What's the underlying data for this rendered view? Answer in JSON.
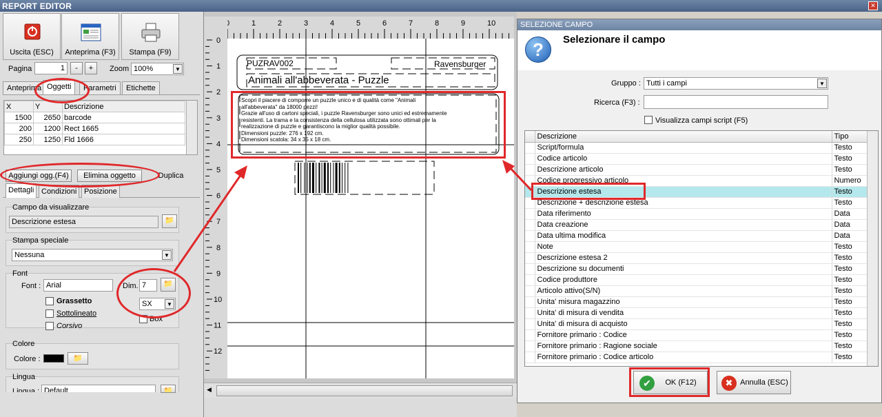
{
  "window": {
    "title": "REPORT EDITOR"
  },
  "toolbar": {
    "exit_label": "Uscita (ESC)",
    "preview_label": "Anteprima (F3)",
    "print_label": "Stampa (F9)",
    "page_label": "Pagina",
    "page_value": "1",
    "minus": "-",
    "plus": "+",
    "zoom_label": "Zoom",
    "zoom_value": "100%"
  },
  "tabs": {
    "preview": "Anteprima",
    "objects": "Oggetti",
    "params": "Parametri",
    "labels": "Etichette"
  },
  "objects": {
    "headers": [
      "X",
      "Y",
      "Descrizione"
    ],
    "rows": [
      [
        "1500",
        "2650",
        "barcode"
      ],
      [
        "200",
        "1200",
        "Rect 1665"
      ],
      [
        "250",
        "1250",
        "Fld 1666"
      ]
    ]
  },
  "obj_buttons": {
    "add": "Aggiungi ogg.(F4)",
    "delete": "Elimina oggetto",
    "duplicate": "Duplica"
  },
  "subtabs": {
    "details": "Dettagli",
    "conditions": "Condizioni",
    "position": "Posizione"
  },
  "field_group": {
    "title": "Campo da visualizzare",
    "value": "Descrizione estesa"
  },
  "special_group": {
    "title": "Stampa speciale",
    "value": "Nessuna"
  },
  "font_group": {
    "title": "Font",
    "font_label": "Font :",
    "font_value": "Arial",
    "dim_label": "Dim.",
    "dim_value": "7",
    "bold": "Grassetto",
    "underline": "Sottolineato",
    "italic": "Corsivo",
    "align_value": "SX",
    "box": "Box"
  },
  "color_group": {
    "title": "Colore",
    "label": "Colore :",
    "value": "#000000"
  },
  "lang_group": {
    "title": "Lingua",
    "label": "Lingua :",
    "value": "Default"
  },
  "ruler": {
    "top": [
      "0",
      "1",
      "2",
      "3",
      "4",
      "5",
      "6",
      "7",
      "8",
      "9",
      "10",
      "11"
    ],
    "left": [
      "0",
      "1",
      "2",
      "3",
      "4",
      "5",
      "6",
      "7",
      "8",
      "9",
      "10",
      "11",
      "12"
    ]
  },
  "label_preview": {
    "code": "PUZRAV002",
    "brand": "Ravensburger",
    "title": "Animali all'abbeverata - Puzzle",
    "desc_lines": [
      "Scopri il piacere di comporre un puzzle unico e di qualità come \"Animali",
      "all'abbeverata\" da 18000 pezzi!",
      "Grazie all'uso di cartoni speciali, i puzzle Ravensburger sono unici ed estremamente",
      "resistenti. La trama e la consistenza della cellulosa utilizzata sono ottimali per la",
      "realizzazione di puzzle e garantiscono la miglior qualità possibile.",
      "Dimensioni puzzle: 276 x 192 cm.",
      "Dimensioni scatola: 34 x 35 x 18 cm."
    ]
  },
  "dialog": {
    "title": "SELEZIONE CAMPO",
    "heading": "Selezionare il campo",
    "group_label": "Gruppo :",
    "group_value": "Tutti i campi",
    "search_label": "Ricerca (F3) :",
    "search_value": "",
    "script_label": "Visualizza campi script (F5)",
    "col_desc": "Descrizione",
    "col_type": "Tipo",
    "ok_label": "OK (F12)",
    "cancel_label": "Annulla (ESC)",
    "fields": [
      {
        "d": "Script/formula",
        "t": "Testo"
      },
      {
        "d": "Codice articolo",
        "t": "Testo"
      },
      {
        "d": "Descrizione articolo",
        "t": "Testo"
      },
      {
        "d": "Codice progressivo articolo",
        "t": "Numero"
      },
      {
        "d": "Descrizione estesa",
        "t": "Testo"
      },
      {
        "d": "Descrizione + descrizione estesa",
        "t": "Testo"
      },
      {
        "d": "Data riferimento",
        "t": "Data"
      },
      {
        "d": "Data creazione",
        "t": "Data"
      },
      {
        "d": "Data ultima modifica",
        "t": "Data"
      },
      {
        "d": "Note",
        "t": "Testo"
      },
      {
        "d": "Descrizione estesa 2",
        "t": "Testo"
      },
      {
        "d": "Descrizione su documenti",
        "t": "Testo"
      },
      {
        "d": "Codice produttore",
        "t": "Testo"
      },
      {
        "d": "Articolo attivo(S/N)",
        "t": "Testo"
      },
      {
        "d": "Unita' misura magazzino",
        "t": "Testo"
      },
      {
        "d": "Unita' di misura di vendita",
        "t": "Testo"
      },
      {
        "d": "Unita' di misura di acquisto",
        "t": "Testo"
      },
      {
        "d": "Fornitore primario : Codice",
        "t": "Testo"
      },
      {
        "d": "Fornitore primario : Ragione sociale",
        "t": "Testo"
      },
      {
        "d": "Fornitore primario : Codice articolo",
        "t": "Testo"
      }
    ]
  }
}
